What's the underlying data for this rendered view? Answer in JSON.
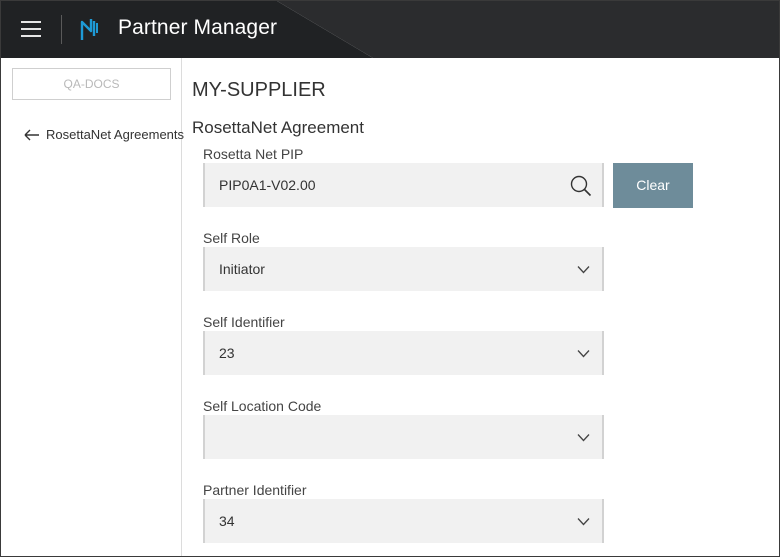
{
  "header": {
    "app_title": "Partner Manager",
    "menu_icon": "hamburger-menu-icon",
    "logo_icon": "webmethods-logo-icon"
  },
  "sidebar": {
    "tenant_label": "QA-DOCS",
    "back_link_label": "RosettaNet Agreements",
    "back_icon": "arrow-left-icon"
  },
  "main": {
    "page_title": "MY-SUPPLIER",
    "section_title": "RosettaNet Agreement",
    "fields": {
      "pip": {
        "label": "Rosetta Net PIP",
        "value": "PIP0A1-V02.00",
        "icon": "search-icon"
      },
      "self_role": {
        "label": "Self Role",
        "value": "Initiator",
        "icon": "chevron-down-icon"
      },
      "self_identifier": {
        "label": "Self Identifier",
        "value": "23",
        "icon": "chevron-down-icon"
      },
      "self_location_code": {
        "label": "Self Location Code",
        "value": "",
        "icon": "chevron-down-icon"
      },
      "partner_identifier": {
        "label": "Partner Identifier",
        "value": "34",
        "icon": "chevron-down-icon"
      }
    },
    "clear_button_label": "Clear"
  },
  "colors": {
    "header_bg": "#202224",
    "clear_button_bg": "#6e8c9a",
    "logo_accent": "#1e9ad6",
    "field_bg": "#f1f1f1"
  }
}
